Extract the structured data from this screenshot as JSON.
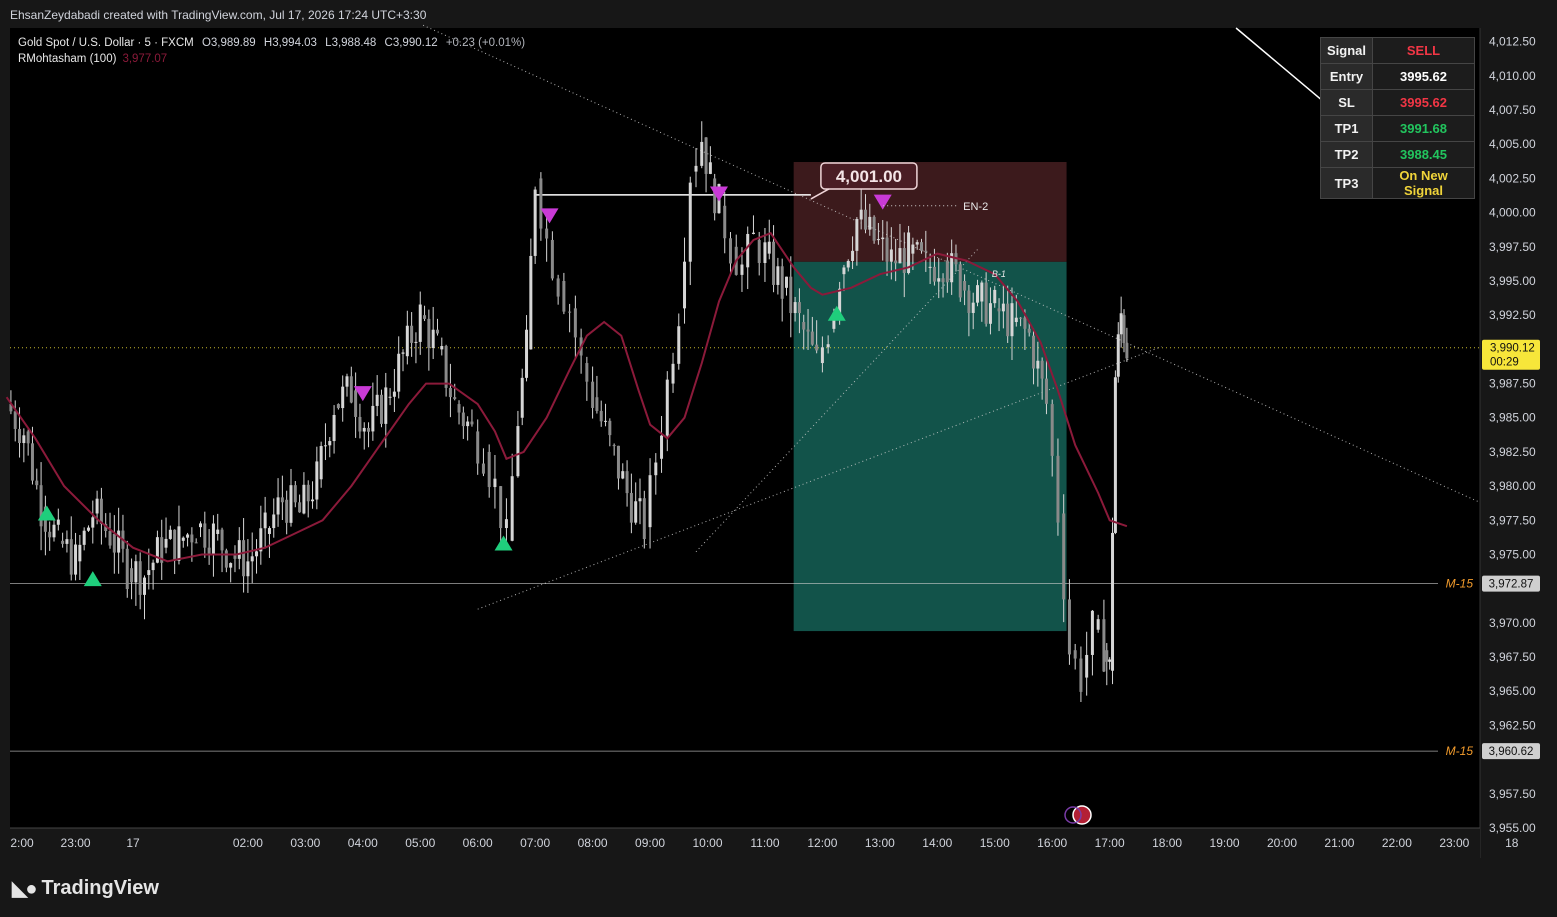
{
  "header": {
    "attribution": "EhsanZeydabadi created with TradingView.com, Jul 17, 2026 17:24 UTC+3:30"
  },
  "legend": {
    "symbol": "Gold Spot / U.S. Dollar · 5 · FXCM",
    "o_label": "O",
    "o": "3,989.89",
    "h_label": "H",
    "h": "3,994.03",
    "l_label": "L",
    "l": "3,988.48",
    "c_label": "C",
    "c": "3,990.12",
    "change": "+0.23 (+0.01%)",
    "indicator": "RMohtasham (100)",
    "indicator_value": "3,977.07"
  },
  "signal_table": [
    {
      "label": "Signal",
      "value": "SELL",
      "color": "#f23645"
    },
    {
      "label": "Entry",
      "value": "3995.62",
      "color": "#ffffff"
    },
    {
      "label": "SL",
      "value": "3995.62",
      "color": "#f23645"
    },
    {
      "label": "TP1",
      "value": "3991.68",
      "color": "#22c55e"
    },
    {
      "label": "TP2",
      "value": "3988.45",
      "color": "#22c55e"
    },
    {
      "label": "TP3",
      "value": "On New Signal",
      "color": "#f0d43a"
    }
  ],
  "branding": {
    "logo_text": "TradingView"
  },
  "colors": {
    "background": "#000000",
    "candle": "#d6d6d6",
    "ma_line": "#8b1a3a",
    "buy_marker": "#1fce7c",
    "sell_marker": "#c93ad6",
    "risk_zone": "#3f1b1e",
    "reward_zone": "#13574e",
    "last_price": "#f7e63a",
    "level_label": "#f39c2c"
  },
  "chart_data": {
    "type": "candlestick",
    "symbol": "Gold Spot / U.S. Dollar",
    "timeframe": "5",
    "ylim": [
      3955.0,
      4013.5
    ],
    "y_ticks": [
      "4,012.50",
      "4,010.00",
      "4,007.50",
      "4,005.00",
      "4,002.50",
      "4,000.00",
      "3,997.50",
      "3,995.00",
      "3,992.50",
      "3,987.50",
      "3,985.00",
      "3,982.50",
      "3,980.00",
      "3,977.50",
      "3,975.00",
      "3,970.00",
      "3,967.50",
      "3,965.00",
      "3,962.50",
      "3,957.50",
      "3,955.00"
    ],
    "x_ticks": [
      "2:00",
      "23:00",
      "17",
      "02:00",
      "03:00",
      "04:00",
      "05:00",
      "06:00",
      "07:00",
      "08:00",
      "09:00",
      "10:00",
      "11:00",
      "12:00",
      "13:00",
      "14:00",
      "15:00",
      "16:00",
      "17:00",
      "18:00",
      "19:00",
      "20:00",
      "21:00",
      "22:00",
      "23:00",
      "18"
    ],
    "x_tick_hours": [
      -2.0,
      -1.0,
      0.0,
      2.0,
      3.0,
      4.0,
      5.0,
      6.0,
      7.0,
      8.0,
      9.0,
      10.0,
      11.0,
      12.0,
      13.0,
      14.0,
      15.0,
      16.0,
      17.0,
      18.0,
      19.0,
      20.0,
      21.0,
      22.0,
      23.0,
      24.0
    ],
    "price_series": {
      "hours": [
        -2.2,
        -1.9,
        -1.6,
        -1.3,
        -1.0,
        -0.7,
        -0.4,
        -0.1,
        0.2,
        0.5,
        0.8,
        1.1,
        1.4,
        1.7,
        2.0,
        2.3,
        2.6,
        2.9,
        3.2,
        3.5,
        3.8,
        4.1,
        4.4,
        4.7,
        5.0,
        5.3,
        5.6,
        5.9,
        6.1,
        6.3,
        6.5,
        6.7,
        6.85,
        7.0,
        7.2,
        7.4,
        7.6,
        7.8,
        8.0,
        8.3,
        8.6,
        8.9,
        9.1,
        9.3,
        9.5,
        9.7,
        9.9,
        10.05,
        10.2,
        10.4,
        10.6,
        10.8,
        11.0,
        11.3,
        11.6,
        11.9,
        12.1,
        12.3,
        12.6,
        12.9,
        13.2,
        13.5,
        13.8,
        14.1,
        14.4,
        14.7,
        15.0,
        15.3,
        15.6,
        15.9,
        16.1,
        16.3,
        16.5,
        16.7,
        16.9,
        17.0,
        17.1,
        17.2,
        17.3
      ],
      "close": [
        3986.0,
        3984.0,
        3978.5,
        3976.0,
        3974.5,
        3978.0,
        3976.5,
        3974.0,
        3973.5,
        3975.5,
        3976.0,
        3977.0,
        3976.5,
        3975.0,
        3974.5,
        3976.5,
        3979.0,
        3978.0,
        3980.5,
        3986.0,
        3987.0,
        3984.0,
        3986.5,
        3989.5,
        3992.5,
        3990.0,
        3986.0,
        3984.0,
        3982.5,
        3980.0,
        3976.0,
        3985.0,
        3990.0,
        4002.5,
        3998.0,
        3995.0,
        3993.0,
        3989.0,
        3986.5,
        3983.0,
        3979.5,
        3977.0,
        3982.0,
        3987.5,
        3993.0,
        4003.0,
        4005.5,
        4002.5,
        4000.5,
        3997.5,
        3996.0,
        3998.0,
        3997.0,
        3994.5,
        3992.0,
        3989.0,
        3991.5,
        3995.5,
        3999.5,
        3998.0,
        3996.5,
        3997.0,
        3996.0,
        3996.5,
        3995.0,
        3993.5,
        3993.0,
        3992.0,
        3991.0,
        3986.0,
        3978.0,
        3968.0,
        3966.0,
        3969.5,
        3968.0,
        3966.5,
        3988.0,
        3992.5,
        3990.12
      ]
    },
    "ma_series": {
      "name": "RMohtasham (100)",
      "hours": [
        -2.2,
        -1.7,
        -1.2,
        -0.6,
        0.0,
        0.6,
        1.2,
        1.8,
        2.3,
        2.8,
        3.3,
        3.8,
        4.3,
        4.8,
        5.1,
        5.5,
        6.0,
        6.3,
        6.5,
        6.8,
        7.2,
        7.6,
        7.9,
        8.2,
        8.5,
        8.8,
        9.0,
        9.3,
        9.6,
        9.9,
        10.2,
        10.5,
        10.8,
        11.1,
        11.5,
        11.8,
        12.0,
        12.5,
        13.0,
        13.5,
        14.0,
        14.5,
        15.0,
        15.4,
        15.8,
        16.1,
        16.4,
        16.8,
        17.0,
        17.3
      ],
      "values": [
        3986.5,
        3983.5,
        3980.0,
        3977.5,
        3975.5,
        3974.5,
        3975.0,
        3975.0,
        3975.5,
        3976.5,
        3977.5,
        3980.0,
        3983.0,
        3986.0,
        3987.5,
        3987.5,
        3986.0,
        3984.0,
        3982.0,
        3982.5,
        3985.0,
        3988.5,
        3991.0,
        3992.0,
        3991.0,
        3987.0,
        3984.5,
        3983.5,
        3985.0,
        3989.0,
        3993.5,
        3996.5,
        3998.0,
        3998.5,
        3996.0,
        3994.5,
        3994.0,
        3994.5,
        3995.5,
        3996.0,
        3997.0,
        3996.5,
        3995.5,
        3993.5,
        3990.5,
        3987.0,
        3983.0,
        3979.5,
        3977.5,
        3977.07
      ]
    },
    "position_tool": {
      "side": "short",
      "start_hour": 11.5,
      "end_hour": 16.25,
      "stop_top": 4003.7,
      "entry": 3996.4,
      "target": 3969.4
    },
    "horizontal_levels": [
      {
        "label": "M-15",
        "value": 3972.87,
        "price_tag": "3,972.87"
      },
      {
        "label": "M-15",
        "value": 3960.62,
        "price_tag": "3,960.62"
      }
    ],
    "last_price": {
      "value": 3990.12,
      "price_tag": "3,990.12",
      "countdown": "00:29"
    },
    "callout": {
      "text": "4,001.00",
      "hour": 11.8,
      "value": 4001.0
    },
    "text_marks": [
      {
        "text": "EN-2",
        "hour": 14.45,
        "value": 4000.5
      },
      {
        "text": "B-1",
        "hour": 14.95,
        "value": 3995.6
      }
    ],
    "buy_signals": [
      {
        "hour": -1.5,
        "value": 3978.0
      },
      {
        "hour": -0.7,
        "value": 3973.2
      },
      {
        "hour": 6.45,
        "value": 3975.8
      },
      {
        "hour": 12.25,
        "value": 3992.6
      }
    ],
    "sell_signals": [
      {
        "hour": 4.0,
        "value": 3986.8
      },
      {
        "hour": 7.25,
        "value": 3999.8
      },
      {
        "hour": 10.2,
        "value": 4001.4
      },
      {
        "hour": 13.05,
        "value": 4000.8
      }
    ],
    "trendlines": [
      {
        "from": [
          6.0,
          3971.0
        ],
        "to": [
          17.9,
          3990.2
        ],
        "style": "dotted"
      },
      {
        "from": [
          9.8,
          3975.2
        ],
        "to": [
          14.7,
          3997.3
        ],
        "style": "dotted"
      },
      {
        "from": [
          5.05,
          4013.7
        ],
        "to": [
          24.4,
          3977.0
        ],
        "style": "dotted"
      },
      {
        "from": [
          7.0,
          4001.3
        ],
        "to": [
          11.8,
          4001.3
        ],
        "style": "solid"
      },
      {
        "from": [
          19.2,
          4013.5
        ],
        "to": [
          20.7,
          4008.2
        ],
        "style": "solid"
      }
    ]
  }
}
